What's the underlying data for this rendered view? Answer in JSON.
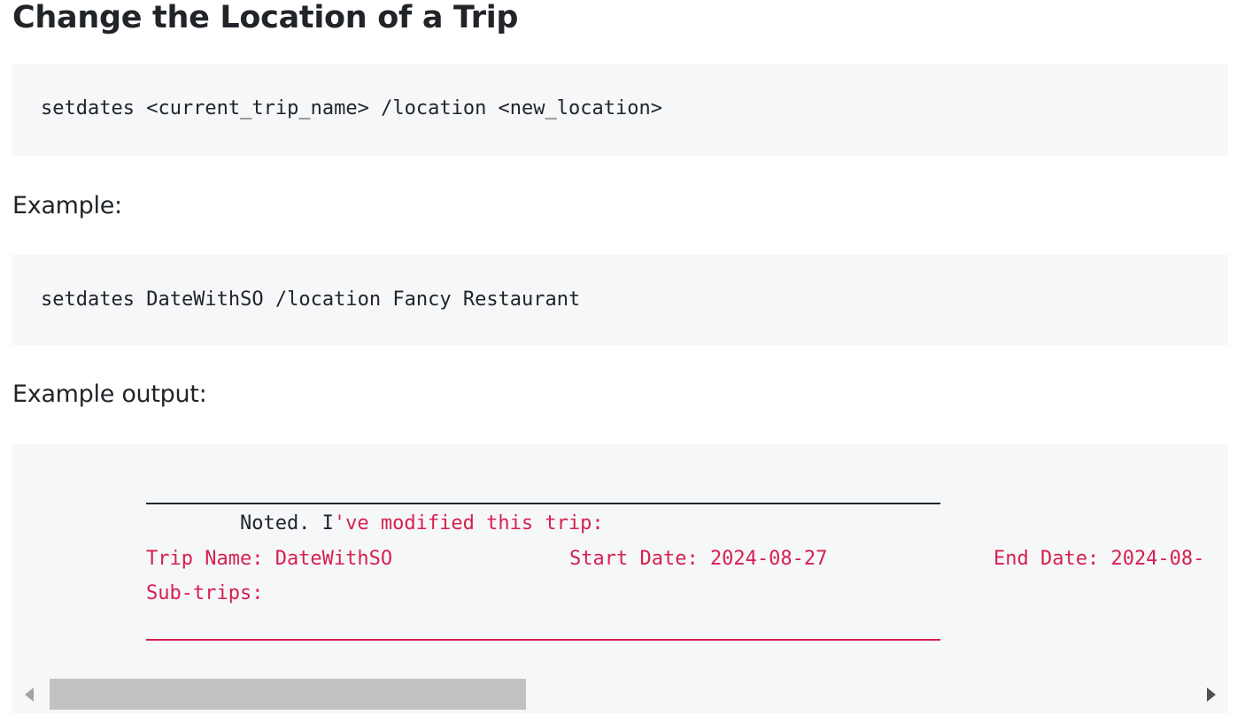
{
  "heading": "Change the Location of a Trip",
  "syntax_code": "setdates <current_trip_name> /location <new_location>",
  "example_label": "Example:",
  "example_code": "setdates DateWithSO /location Fancy Restaurant",
  "output_label": "Example output:",
  "output": {
    "line1_prefix": "        Noted. I",
    "line1_rest": "'ve modified this trip:",
    "trip_name": "Trip Name: DateWithSO",
    "start_date": "Start Date: 2024-08-27",
    "end_date": "End Date: 2024-08-",
    "sub_trips": "Sub-trips:"
  },
  "colors": {
    "code_background": "#f6f7f8",
    "highlight_red": "#d6204f",
    "text": "#212529"
  },
  "icons": {
    "scroll_left": "triangle-left",
    "scroll_right": "triangle-right"
  }
}
